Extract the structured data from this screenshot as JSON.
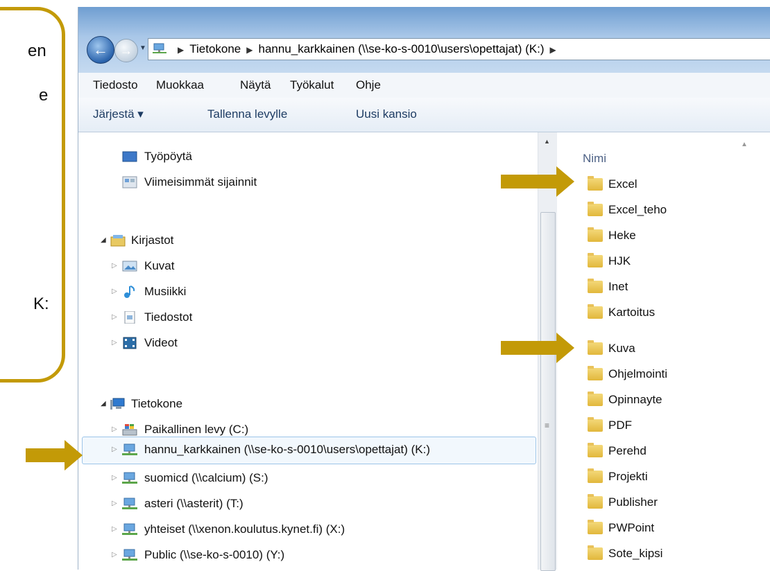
{
  "callout": {
    "line1": "en",
    "line2": "e",
    "line3": "K:"
  },
  "address": {
    "crumb1": "Tietokone",
    "crumb2": "hannu_karkkainen (\\\\se-ko-s-0010\\users\\opettajat) (K:)"
  },
  "menu": [
    "Tiedosto",
    "Muokkaa",
    "Näytä",
    "Työkalut",
    "Ohje"
  ],
  "toolbar": {
    "organize": "Järjestä ▾",
    "burn": "Tallenna levylle",
    "new_folder": "Uusi kansio"
  },
  "nav": {
    "desktop": "Työpöytä",
    "recent": "Viimeisimmät sijainnit",
    "libraries": "Kirjastot",
    "pictures": "Kuvat",
    "music": "Musiikki",
    "documents": "Tiedostot",
    "videos": "Videot",
    "computer": "Tietokone",
    "drives": [
      "Paikallinen levy (C:)",
      "hannu_karkkainen (\\\\se-ko-s-0010\\users\\opettajat) (K:)",
      "suomicd (\\\\calcium) (S:)",
      "asteri (\\\\asterit) (T:)",
      "yhteiset (\\\\xenon.koulutus.kynet.fi) (X:)",
      "Public (\\\\se-ko-s-0010) (Y:)"
    ]
  },
  "content": {
    "column_header": "Nimi",
    "folders": [
      "Excel",
      "Excel_teho",
      "Heke",
      "HJK",
      "Inet",
      "Kartoitus",
      "Kuva",
      "Ohjelmointi",
      "Opinnayte",
      "PDF",
      "Perehd",
      "Projekti",
      "Publisher",
      "PWPoint",
      "Sote_kipsi"
    ]
  },
  "colors": {
    "accent": "#c39a07",
    "selection": "#9cc4e8"
  }
}
